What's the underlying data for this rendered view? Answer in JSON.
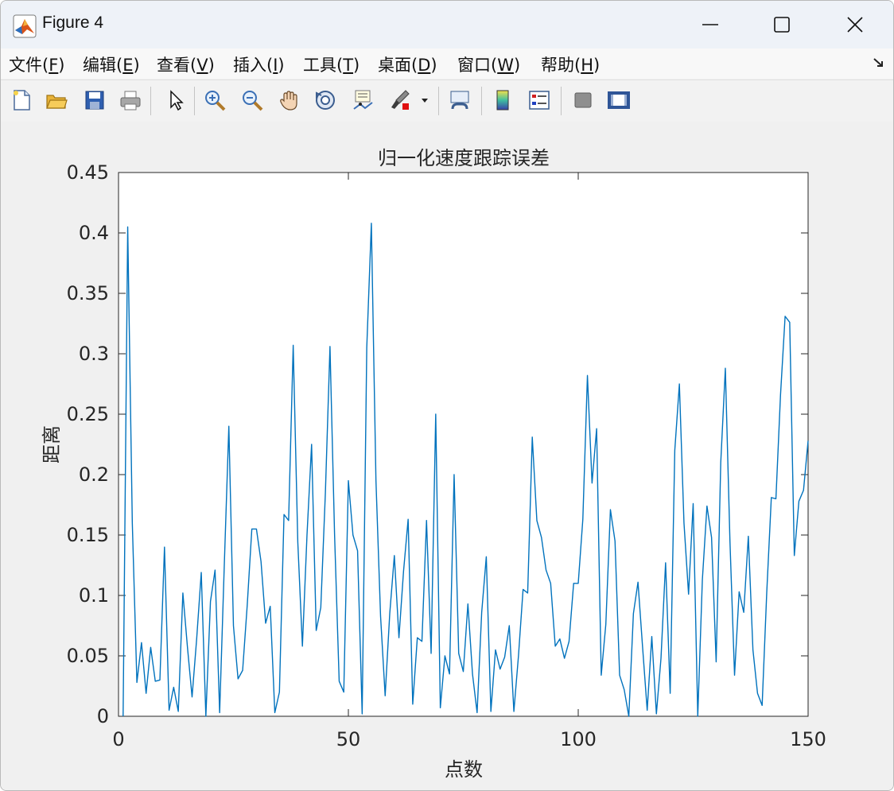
{
  "window": {
    "title": "Figure 4"
  },
  "menu": [
    {
      "label": "文件(",
      "key": "F",
      "close": ")"
    },
    {
      "label": "编辑(",
      "key": "E",
      "close": ")"
    },
    {
      "label": "查看(",
      "key": "V",
      "close": ")"
    },
    {
      "label": "插入(",
      "key": "I",
      "close": ")"
    },
    {
      "label": "工具(",
      "key": "T",
      "close": ")"
    },
    {
      "label": "桌面(",
      "key": "D",
      "close": ")"
    },
    {
      "label": "窗口(",
      "key": "W",
      "close": ")"
    },
    {
      "label": "帮助(",
      "key": "H",
      "close": ")"
    }
  ],
  "toolbar_icons": [
    "new-file-icon",
    "open-folder-icon",
    "save-icon",
    "print-icon",
    "pointer-icon",
    "zoom-in-icon",
    "zoom-out-icon",
    "pan-hand-icon",
    "rotate-3d-icon",
    "data-cursor-icon",
    "brush-icon",
    "link-plot-icon",
    "colorbar-icon",
    "legend-icon",
    "hide-plot-tools-icon",
    "show-plot-tools-icon"
  ],
  "colors": {
    "line": "#0072bd",
    "axes": "#262626",
    "plot_bg": "#ffffff",
    "figure_bg": "#f0f0f0"
  },
  "chart_data": {
    "type": "line",
    "title": "归一化速度跟踪误差",
    "xlabel": "点数",
    "ylabel": "距离",
    "xlim": [
      0,
      150
    ],
    "ylim": [
      0,
      0.45
    ],
    "xticks": [
      "0",
      "50",
      "100",
      "150"
    ],
    "yticks": [
      "0",
      "0.05",
      "0.1",
      "0.15",
      "0.2",
      "0.25",
      "0.3",
      "0.35",
      "0.4",
      "0.45"
    ],
    "grid": false,
    "x": [
      1,
      2,
      3,
      4,
      5,
      6,
      7,
      8,
      9,
      10,
      11,
      12,
      13,
      14,
      15,
      16,
      17,
      18,
      19,
      20,
      21,
      22,
      23,
      24,
      25,
      26,
      27,
      28,
      29,
      30,
      31,
      32,
      33,
      34,
      35,
      36,
      37,
      38,
      39,
      40,
      41,
      42,
      43,
      44,
      45,
      46,
      47,
      48,
      49,
      50,
      51,
      52,
      53,
      54,
      55,
      56,
      57,
      58,
      59,
      60,
      61,
      62,
      63,
      64,
      65,
      66,
      67,
      68,
      69,
      70,
      71,
      72,
      73,
      74,
      75,
      76,
      77,
      78,
      79,
      80,
      81,
      82,
      83,
      84,
      85,
      86,
      87,
      88,
      89,
      90,
      91,
      92,
      93,
      94,
      95,
      96,
      97,
      98,
      99,
      100,
      101,
      102,
      103,
      104,
      105,
      106,
      107,
      108,
      109,
      110,
      111,
      112,
      113,
      114,
      115,
      116,
      117,
      118,
      119,
      120,
      121,
      122,
      123,
      124,
      125,
      126,
      127,
      128,
      129,
      130,
      131,
      132,
      133,
      134,
      135,
      136,
      137,
      138,
      139,
      140,
      141,
      142,
      143,
      144,
      145,
      146,
      147,
      148,
      149,
      150
    ],
    "y": [
      0.0,
      0.405,
      0.16,
      0.028,
      0.061,
      0.019,
      0.057,
      0.029,
      0.03,
      0.14,
      0.005,
      0.024,
      0.004,
      0.102,
      0.057,
      0.016,
      0.064,
      0.119,
      0.0,
      0.095,
      0.121,
      0.003,
      0.124,
      0.24,
      0.075,
      0.031,
      0.038,
      0.092,
      0.155,
      0.155,
      0.128,
      0.077,
      0.091,
      0.003,
      0.02,
      0.167,
      0.162,
      0.307,
      0.144,
      0.058,
      0.15,
      0.225,
      0.071,
      0.09,
      0.185,
      0.306,
      0.15,
      0.029,
      0.02,
      0.195,
      0.15,
      0.137,
      0.002,
      0.305,
      0.408,
      0.195,
      0.083,
      0.017,
      0.085,
      0.133,
      0.065,
      0.12,
      0.163,
      0.01,
      0.065,
      0.062,
      0.162,
      0.052,
      0.25,
      0.007,
      0.05,
      0.035,
      0.2,
      0.052,
      0.037,
      0.093,
      0.035,
      0.003,
      0.086,
      0.132,
      0.004,
      0.055,
      0.039,
      0.049,
      0.075,
      0.004,
      0.05,
      0.105,
      0.102,
      0.231,
      0.162,
      0.148,
      0.121,
      0.11,
      0.058,
      0.064,
      0.048,
      0.062,
      0.11,
      0.11,
      0.163,
      0.282,
      0.193,
      0.238,
      0.034,
      0.076,
      0.171,
      0.145,
      0.034,
      0.022,
      0.0,
      0.085,
      0.111,
      0.057,
      0.005,
      0.066,
      0.002,
      0.048,
      0.127,
      0.019,
      0.22,
      0.275,
      0.16,
      0.101,
      0.176,
      0.0,
      0.113,
      0.174,
      0.148,
      0.045,
      0.21,
      0.288,
      0.145,
      0.034,
      0.103,
      0.086,
      0.149,
      0.055,
      0.019,
      0.009,
      0.102,
      0.181,
      0.18,
      0.266,
      0.331,
      0.326,
      0.133,
      0.178,
      0.187,
      0.228
    ]
  }
}
